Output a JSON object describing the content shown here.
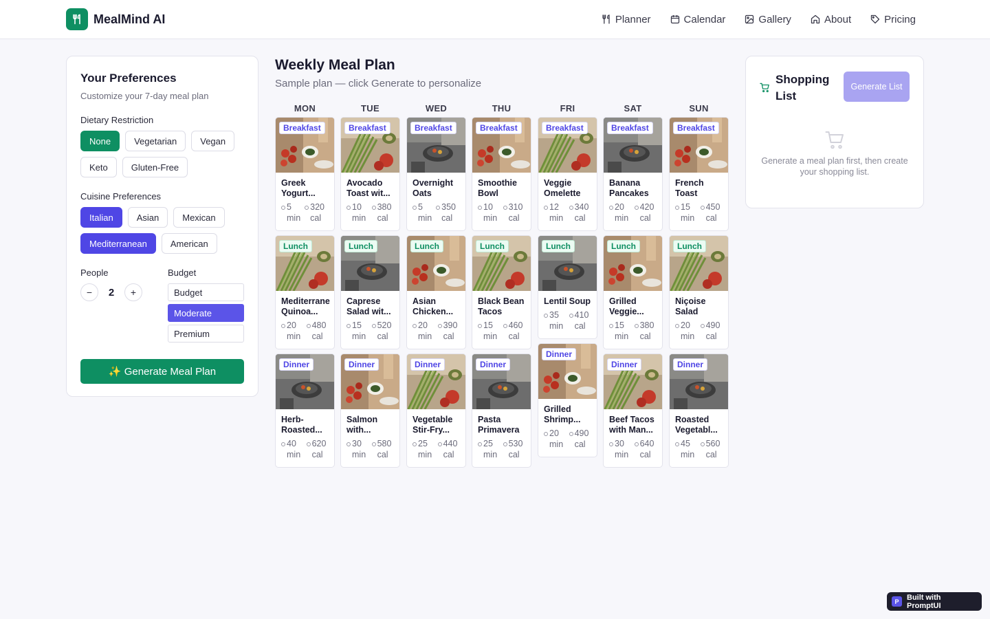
{
  "header": {
    "brand": "MealMind AI",
    "nav": [
      {
        "label": "Planner",
        "icon": "utensils-icon"
      },
      {
        "label": "Calendar",
        "icon": "calendar-icon"
      },
      {
        "label": "Gallery",
        "icon": "image-icon"
      },
      {
        "label": "About",
        "icon": "home-icon"
      },
      {
        "label": "Pricing",
        "icon": "tag-icon"
      }
    ]
  },
  "preferences": {
    "title": "Your Preferences",
    "subtitle": "Customize your 7-day meal plan",
    "dietary_label": "Dietary Restriction",
    "dietary": [
      {
        "label": "None",
        "selected": true
      },
      {
        "label": "Vegetarian",
        "selected": false
      },
      {
        "label": "Vegan",
        "selected": false
      },
      {
        "label": "Keto",
        "selected": false
      },
      {
        "label": "Gluten-Free",
        "selected": false
      }
    ],
    "cuisine_label": "Cuisine Preferences",
    "cuisine": [
      {
        "label": "Italian",
        "selected": true
      },
      {
        "label": "Asian",
        "selected": false
      },
      {
        "label": "Mexican",
        "selected": false
      },
      {
        "label": "Mediterranean",
        "selected": true
      },
      {
        "label": "American",
        "selected": false
      }
    ],
    "people_label": "People",
    "people_minus": "−",
    "people_value": "2",
    "people_plus": "+",
    "budget_label": "Budget",
    "budget_options": [
      {
        "label": "Budget",
        "selected": false
      },
      {
        "label": "Moderate",
        "selected": true
      },
      {
        "label": "Premium",
        "selected": false
      }
    ],
    "generate_label": "✨ Generate Meal Plan"
  },
  "plan": {
    "title": "Weekly Meal Plan",
    "subtitle": "Sample plan — click Generate to personalize",
    "days": [
      "MON",
      "TUE",
      "WED",
      "THU",
      "FRI",
      "SAT",
      "SUN"
    ],
    "meals": {
      "breakfast": {
        "label": "Breakfast",
        "items": [
          {
            "name": "Greek Yogurt...",
            "time": "5 min",
            "cal": "320 cal",
            "photo": "vegetables"
          },
          {
            "name": "Avocado Toast wit...",
            "time": "10 min",
            "cal": "380 cal",
            "photo": "asparagus"
          },
          {
            "name": "Overnight Oats",
            "time": "5 min",
            "cal": "350 cal",
            "photo": "kitchen"
          },
          {
            "name": "Smoothie Bowl",
            "time": "10 min",
            "cal": "310 cal",
            "photo": "vegetables"
          },
          {
            "name": "Veggie Omelette",
            "time": "12 min",
            "cal": "340 cal",
            "photo": "asparagus"
          },
          {
            "name": "Banana Pancakes",
            "time": "20 min",
            "cal": "420 cal",
            "photo": "kitchen"
          },
          {
            "name": "French Toast",
            "time": "15 min",
            "cal": "450 cal",
            "photo": "vegetables"
          }
        ]
      },
      "lunch": {
        "label": "Lunch",
        "items": [
          {
            "name": "Mediterrane Quinoa...",
            "time": "20 min",
            "cal": "480 cal",
            "photo": "asparagus"
          },
          {
            "name": "Caprese Salad wit...",
            "time": "15 min",
            "cal": "520 cal",
            "photo": "kitchen"
          },
          {
            "name": "Asian Chicken...",
            "time": "20 min",
            "cal": "390 cal",
            "photo": "vegetables"
          },
          {
            "name": "Black Bean Tacos",
            "time": "15 min",
            "cal": "460 cal",
            "photo": "asparagus"
          },
          {
            "name": "Lentil Soup",
            "time": "35 min",
            "cal": "410 cal",
            "photo": "kitchen"
          },
          {
            "name": "Grilled Veggie...",
            "time": "15 min",
            "cal": "380 cal",
            "photo": "vegetables"
          },
          {
            "name": "Niçoise Salad",
            "time": "20 min",
            "cal": "490 cal",
            "photo": "asparagus"
          }
        ]
      },
      "dinner": {
        "label": "Dinner",
        "items": [
          {
            "name": "Herb-Roasted...",
            "time": "40 min",
            "cal": "620 cal",
            "photo": "kitchen"
          },
          {
            "name": "Salmon with...",
            "time": "30 min",
            "cal": "580 cal",
            "photo": "vegetables"
          },
          {
            "name": "Vegetable Stir-Fry...",
            "time": "25 min",
            "cal": "440 cal",
            "photo": "asparagus"
          },
          {
            "name": "Pasta Primavera",
            "time": "25 min",
            "cal": "530 cal",
            "photo": "kitchen"
          },
          {
            "name": "Grilled Shrimp...",
            "time": "20 min",
            "cal": "490 cal",
            "photo": "vegetables"
          },
          {
            "name": "Beef Tacos with Man...",
            "time": "30 min",
            "cal": "640 cal",
            "photo": "asparagus"
          },
          {
            "name": "Roasted Vegetabl...",
            "time": "45 min",
            "cal": "560 cal",
            "photo": "kitchen"
          }
        ]
      }
    }
  },
  "shopping": {
    "title": "Shopping List",
    "button": "Generate List",
    "empty_text": "Generate a meal plan first, then create your shopping list."
  },
  "footer": {
    "badge_letter": "P",
    "built_text": "Built with PromptUI"
  },
  "colors": {
    "brand_green": "#0e8f62",
    "indigo": "#4f46e5",
    "disabled_indigo": "#a9a4f1"
  }
}
